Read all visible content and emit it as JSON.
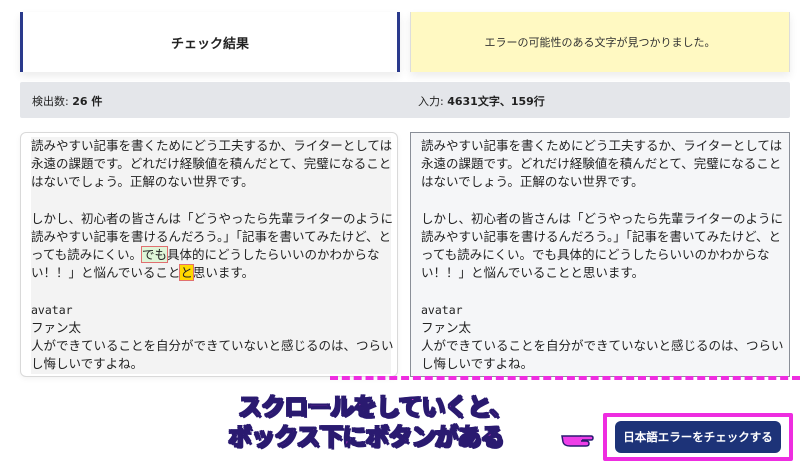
{
  "header": {
    "title": "チェック結果",
    "message": "エラーの可能性のある文字が見つかりました。"
  },
  "stats": {
    "count_label": "検出数: ",
    "count_value": "26 件",
    "input_label": "入力: ",
    "input_value": "4631文字、159行"
  },
  "left_pane": {
    "lines": [
      "読みやすい記事を書くためにどう工夫するか、ライターとしては",
      "永遠の課題です。どれだけ経験値を積んだとて、完璧になること",
      "はないでしょう。正解のない世界です。",
      "",
      "しかし、初心者の皆さんは「どうやったら先輩ライターのように",
      "読みやすい記事を書けるんだろう。」「記事を書いてみたけど、と",
      "って",
      "い！！」と悩んでいること",
      "",
      "avatar",
      "ファン太",
      "人ができていることを自分ができていないと感じるのは、つらい",
      "し悔しいですよね。"
    ],
    "line7_a": "っても読みにくい。",
    "line7_hl": "でも",
    "line7_b": "具体的にどうしたらいいのかわからな",
    "line8_a": "い！！」と悩んでいること",
    "line8_hl": "と",
    "line8_b": "思います。"
  },
  "right_pane": {
    "lines": [
      "読みやすい記事を書くためにどう工夫するか、ライターとしては",
      "永遠の課題です。どれだけ経験値を積んだとて、完璧になること",
      "はないでしょう。正解のない世界です。",
      "",
      "しかし、初心者の皆さんは「どうやったら先輩ライターのように",
      "読みやすい記事を書けるんだろう。」「記事を書いてみたけど、と",
      "っても読みにくい。でも具体的にどうしたらいいのかわからな",
      "い！！」と悩んでいることと思います。",
      "",
      "avatar",
      "ファン太",
      "人ができていることを自分ができていないと感じるのは、つらい",
      "し悔しいですよね。"
    ]
  },
  "annotation": {
    "line1": "スクロールをしていくと、",
    "line2": "ボックス下にボタンがある"
  },
  "check_button": {
    "label": "日本語エラーをチェックする"
  },
  "colors": {
    "accent": "#1d3378",
    "highlight_pink": "#ee2de0",
    "message_bg": "#fff9c2"
  }
}
